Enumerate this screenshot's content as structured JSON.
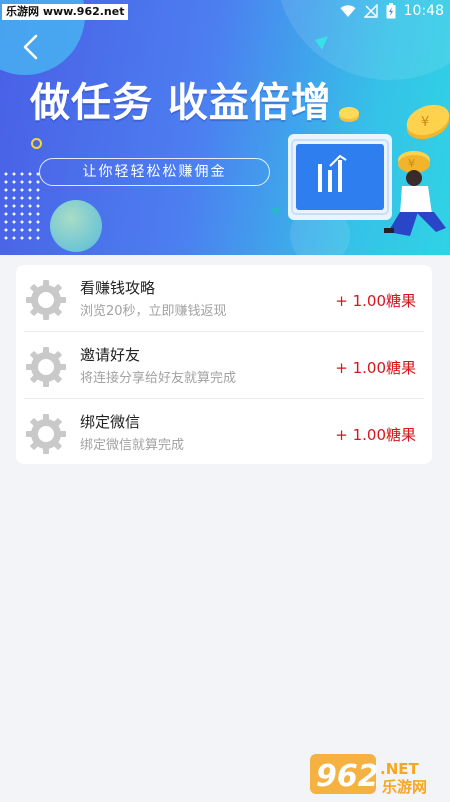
{
  "status_bar": {
    "watermark": "乐游网 www.962.net",
    "time": "10:48"
  },
  "header": {
    "back_icon": "chevron-left-icon",
    "headline": "做任务 收益倍增",
    "subtitle": "让你轻轻松松赚佣金"
  },
  "tasks": [
    {
      "title": "看赚钱攻略",
      "description": "浏览20秒，立即赚钱返现",
      "reward": "+ 1.00糖果",
      "icon": "gear-icon"
    },
    {
      "title": "邀请好友",
      "description": "将连接分享给好友就算完成",
      "reward": "+ 1.00糖果",
      "icon": "gear-icon"
    },
    {
      "title": "绑定微信",
      "description": "绑定微信就算完成",
      "reward": "+ 1.00糖果",
      "icon": "gear-icon"
    }
  ],
  "watermark_bottom": {
    "digits": "962",
    "domain": ".NET",
    "site": "乐游网"
  },
  "colors": {
    "banner_start": "#4a5fe6",
    "banner_end": "#2fd3e4",
    "reward_red": "#d4161d",
    "page_bg": "#f3f4f8"
  }
}
